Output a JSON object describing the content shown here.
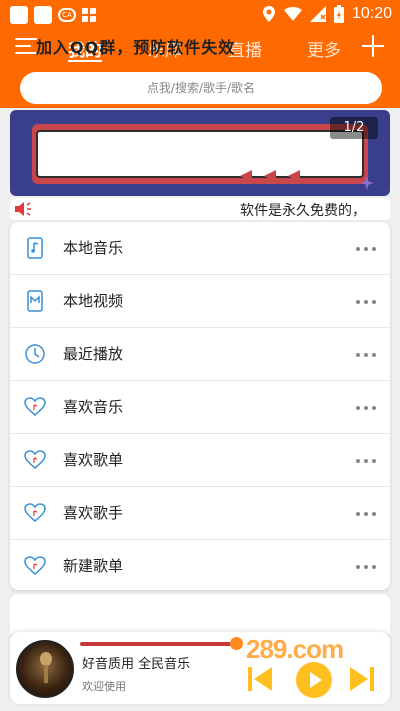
{
  "status_bar": {
    "time": "10:20"
  },
  "header": {
    "tabs": [
      "我的",
      "乐库",
      "直播",
      "更多"
    ],
    "active_tab": "我的"
  },
  "search": {
    "placeholder": "点我/搜索/歌手/歌名"
  },
  "banner": {
    "text": "加入QQ群，预防软件失效",
    "pager": "1/2"
  },
  "notice": {
    "text": "软件是永久免费的，"
  },
  "menu": {
    "items": [
      {
        "label": "本地音乐",
        "icon": "local-music-icon"
      },
      {
        "label": "本地视频",
        "icon": "local-video-icon"
      },
      {
        "label": "最近播放",
        "icon": "clock-icon"
      },
      {
        "label": "喜欢音乐",
        "icon": "heart-icon"
      },
      {
        "label": "喜欢歌单",
        "icon": "heart-icon"
      },
      {
        "label": "喜欢歌手",
        "icon": "heart-icon"
      },
      {
        "label": "新建歌单",
        "icon": "heart-icon"
      }
    ]
  },
  "player": {
    "song": "好音质用 全民音乐",
    "subtitle": "欢迎使用",
    "watermark": "289.com"
  },
  "colors": {
    "brand": "#ff6a00",
    "accent_icon": "#3a8fd6",
    "play_button": "#ffbf1f"
  }
}
